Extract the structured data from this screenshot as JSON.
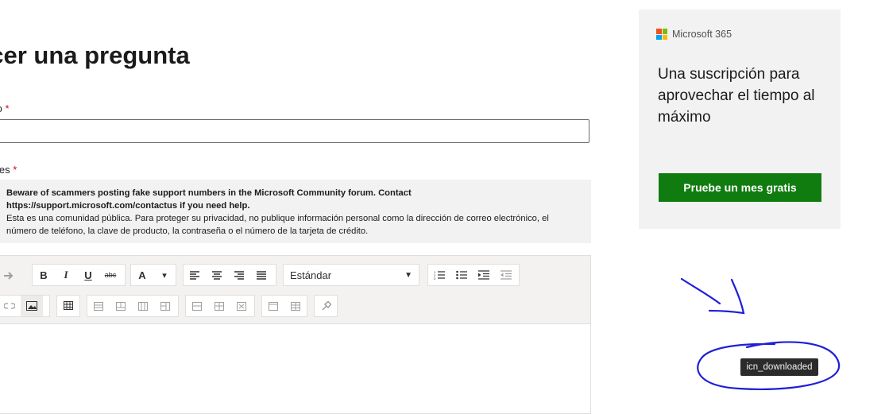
{
  "form": {
    "title": "acer una pregunta",
    "subject_label": "to",
    "details_label": "les",
    "required_mark": "*",
    "subject_value": "",
    "notice": {
      "line1": "Beware of scammers posting fake support numbers in the Microsoft Community forum. Contact",
      "line2": "https://support.microsoft.com/contactus if you need help.",
      "line3": "Esta es una comunidad pública. Para proteger su privacidad, no publique información personal como la dirección de correo electrónico, el",
      "line4": "número de teléfono, la clave de producto, la contraseña o el número de la tarjeta de crédito."
    }
  },
  "toolbar": {
    "redo": "➔",
    "bold": "B",
    "italic": "I",
    "underline": "U",
    "strike": "abc",
    "font_color": "A",
    "font_color_menu": "▾",
    "style_value": "Estándar",
    "style_arrow": "▼",
    "icons": {
      "redo": "redo-icon",
      "align_left": "align-left-icon",
      "align_center": "align-center-icon",
      "align_right": "align-right-icon",
      "justify": "justify-icon",
      "ordered_list": "ordered-list-icon",
      "bullet_list": "bullet-list-icon",
      "indent": "indent-icon",
      "outdent": "outdent-icon",
      "unlink": "unlink-icon",
      "image": "image-icon",
      "table": "table-icon",
      "clear_format": "clear-format-icon"
    }
  },
  "ad": {
    "brand": "Microsoft 365",
    "headline": "Una suscripción para aprovechar el tiempo al máximo",
    "cta": "Pruebe un mes gratis",
    "logo_colors": [
      "#f25022",
      "#7fba00",
      "#00a4ef",
      "#ffb900"
    ],
    "cta_color": "#107c10"
  },
  "tooltip": {
    "text": "icn_downloaded"
  }
}
